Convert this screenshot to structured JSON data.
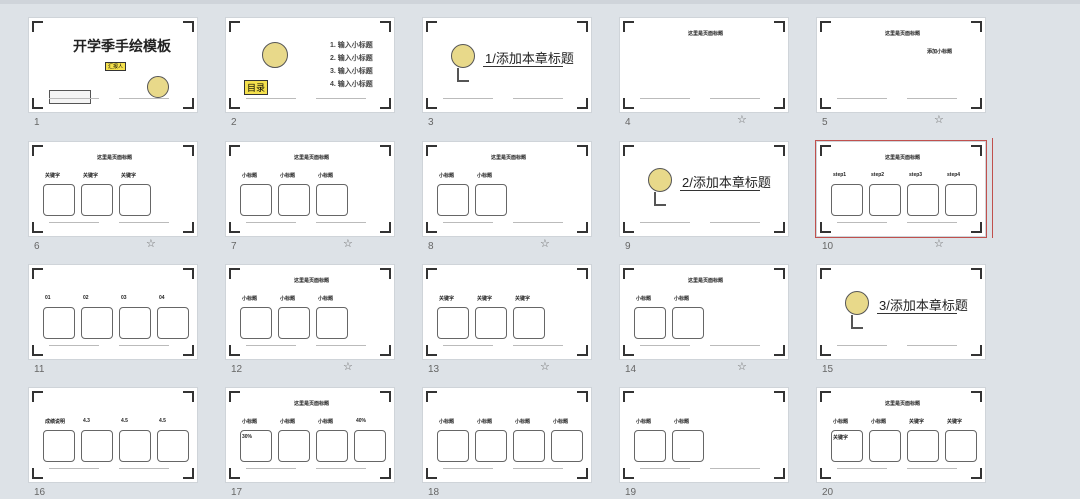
{
  "slides": [
    {
      "n": "1",
      "title": "开学季手绘模板",
      "sub": "汇报人"
    },
    {
      "n": "2",
      "items": [
        "1. 输入小标题",
        "2. 输入小标题",
        "3. 输入小标题",
        "4. 输入小标题"
      ],
      "badge": "目录"
    },
    {
      "n": "3",
      "title": "1/添加本章标题"
    },
    {
      "n": "4",
      "head": "这里是页面标题"
    },
    {
      "n": "5",
      "head": "这里是页面标题",
      "sub": "添加小标题"
    },
    {
      "n": "6",
      "head": "这里是页面标题",
      "labels": [
        "关键字",
        "关键字",
        "关键字"
      ]
    },
    {
      "n": "7",
      "head": "这里是页面标题",
      "labels": [
        "小标题",
        "小标题",
        "小标题"
      ]
    },
    {
      "n": "8",
      "head": "这里是页面标题",
      "labels": [
        "小标题",
        "小标题"
      ]
    },
    {
      "n": "9",
      "title": "2/添加本章标题"
    },
    {
      "n": "10",
      "head": "这里是页面标题",
      "labels": [
        "step1",
        "step2",
        "step3",
        "step4"
      ]
    },
    {
      "n": "11",
      "labels": [
        "01",
        "02",
        "03",
        "04"
      ]
    },
    {
      "n": "12",
      "head": "这里是页面标题",
      "labels": [
        "小标题",
        "小标题",
        "小标题"
      ]
    },
    {
      "n": "13",
      "labels": [
        "关键字",
        "关键字",
        "关键字"
      ]
    },
    {
      "n": "14",
      "head": "这里是页面标题",
      "labels": [
        "小标题",
        "小标题"
      ]
    },
    {
      "n": "15",
      "title": "3/添加本章标题"
    },
    {
      "n": "16",
      "labels": [
        "成绩说明",
        "4.3",
        "4.5",
        "4.5"
      ]
    },
    {
      "n": "17",
      "head": "这里是页面标题",
      "labels": [
        "小标题",
        "小标题",
        "小标题",
        "40%",
        "30%"
      ]
    },
    {
      "n": "18",
      "labels": [
        "小标题",
        "小标题",
        "小标题",
        "小标题"
      ]
    },
    {
      "n": "19",
      "labels": [
        "小标题",
        "小标题"
      ]
    },
    {
      "n": "20",
      "head": "这里是页面标题",
      "labels": [
        "小标题",
        "小标题",
        "关键字",
        "关键字",
        "关键字"
      ]
    }
  ],
  "icons": {
    "star": "☆",
    "corner": "corner-bracket"
  },
  "colors": {
    "background": "#dde2e7",
    "accent_yellow": "#f4e04d",
    "selection": "#c0504d"
  }
}
